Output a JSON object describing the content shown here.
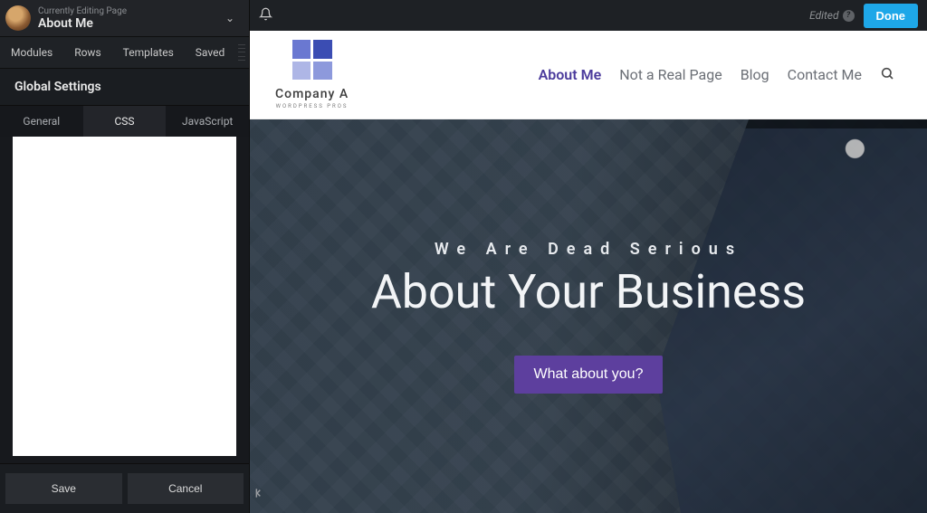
{
  "sidebar": {
    "editing_label": "Currently Editing Page",
    "page_title": "About Me",
    "tabs": [
      "Modules",
      "Rows",
      "Templates",
      "Saved"
    ],
    "panel_title": "Global Settings",
    "settings_tabs": [
      "General",
      "CSS",
      "JavaScript"
    ],
    "active_settings_tab": "CSS",
    "code_value": "",
    "buttons": {
      "save": "Save",
      "cancel": "Cancel"
    }
  },
  "appbar": {
    "edited_label": "Edited",
    "done_label": "Done"
  },
  "site": {
    "logo_name": "Company A",
    "logo_tag": "WORDPRESS PROS",
    "nav": [
      "About Me",
      "Not a Real Page",
      "Blog",
      "Contact Me"
    ],
    "active_nav": "About Me"
  },
  "hero": {
    "kicker": "We Are Dead Serious",
    "headline": "About Your Business",
    "cta": "What about you?"
  }
}
